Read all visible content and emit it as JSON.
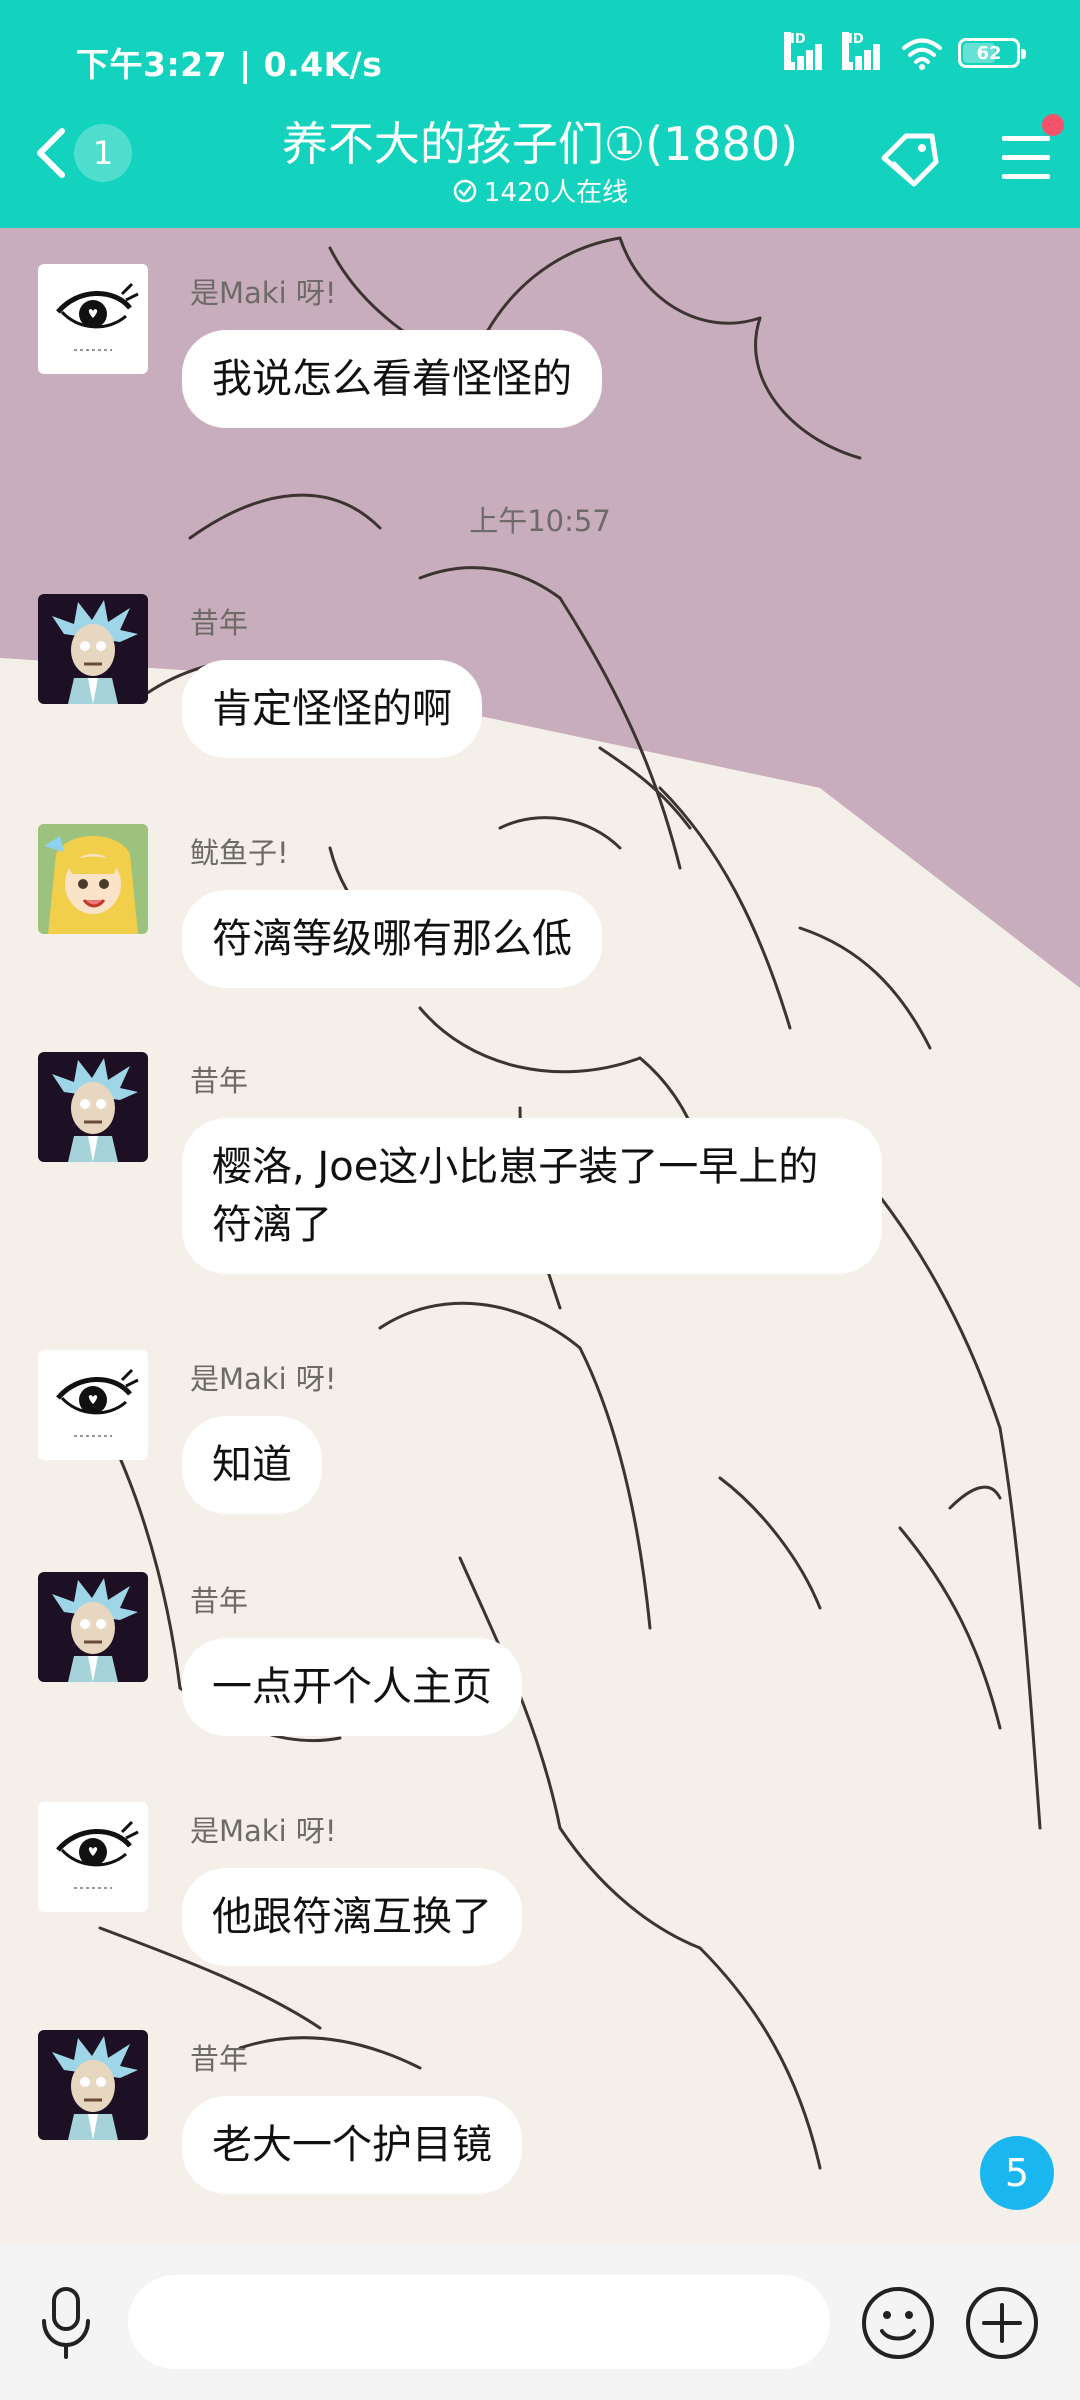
{
  "status_bar": {
    "time": "下午3:27 | 0.4K/s",
    "signal_badge": "HD",
    "battery": "62",
    "battery_level": 0.62
  },
  "header": {
    "back_count": "1",
    "title": "养不大的孩子们①(1880)",
    "online": "1420人在线",
    "bg_color": "#14d3be",
    "has_notification_dot": true
  },
  "messages": [
    {
      "sender": "是Maki 呀!",
      "avatar": "eye-avatar",
      "text": "我说怎么看着怪怪的"
    },
    {
      "sender": "昔年",
      "avatar": "rick-avatar",
      "text": "肯定怪怪的啊"
    },
    {
      "sender": "鱿鱼子!",
      "avatar": "anime-girl-avatar",
      "text": "符漓等级哪有那么低"
    },
    {
      "sender": "昔年",
      "avatar": "rick-avatar",
      "text": "樱洛, Joe这小比崽子装了一早上的符漓了"
    },
    {
      "sender": "是Maki 呀!",
      "avatar": "eye-avatar",
      "text": "知道"
    },
    {
      "sender": "昔年",
      "avatar": "rick-avatar",
      "text": "一点开个人主页"
    },
    {
      "sender": "是Maki 呀!",
      "avatar": "eye-avatar",
      "text": "他跟符漓互换了"
    },
    {
      "sender": "昔年",
      "avatar": "rick-avatar",
      "text": "老大一个护目镜"
    }
  ],
  "timestamp": "上午10:57",
  "unread_count": "5",
  "input": {
    "value": "",
    "placeholder": ""
  }
}
